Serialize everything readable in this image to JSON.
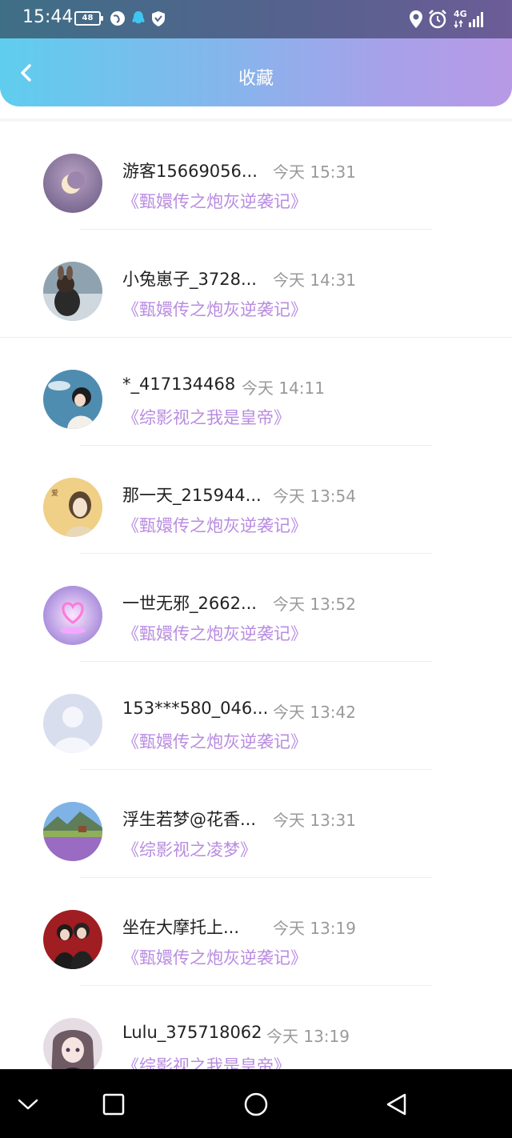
{
  "status": {
    "time": "15:44",
    "battery": "48",
    "network": "4G"
  },
  "header": {
    "title": "收藏"
  },
  "items": [
    {
      "name": "游客15669056...",
      "time": "今天 15:31",
      "book": "《甄嬛传之炮灰逆袭记》",
      "avatar": "moon-avatar"
    },
    {
      "name": "小兔崽子_3728...",
      "time": "今天 14:31",
      "book": "《甄嬛传之炮灰逆袭记》",
      "avatar": "bunny-avatar"
    },
    {
      "name": "*_417134468",
      "time": "今天 14:11",
      "book": "《综影视之我是皇帝》",
      "avatar": "girl-sky-avatar"
    },
    {
      "name": "那一天_215944...",
      "time": "今天 13:54",
      "book": "《甄嬛传之炮灰逆袭记》",
      "avatar": "painted-girl-avatar"
    },
    {
      "name": "一世无邪_2662...",
      "time": "今天 13:52",
      "book": "《甄嬛传之炮灰逆袭记》",
      "avatar": "heart-avatar"
    },
    {
      "name": "153***580_046...",
      "time": "今天 13:42",
      "book": "《甄嬛传之炮灰逆袭记》",
      "avatar": "default-avatar"
    },
    {
      "name": "浮生若梦@花香...",
      "time": "今天 13:31",
      "book": "《综影视之凌梦》",
      "avatar": "lavender-field-avatar"
    },
    {
      "name": "坐在大摩托上...",
      "time": "今天 13:19",
      "book": "《甄嬛传之炮灰逆袭记》",
      "avatar": "couple-avatar"
    },
    {
      "name": "Lulu_375718062",
      "time": "今天 13:19",
      "book": "《综影视之我是皇帝》",
      "avatar": "anime-girl-avatar"
    }
  ],
  "colors": {
    "book_title": "#b88ce0",
    "time": "#9a9a9a",
    "header_start": "#5fcdee",
    "header_end": "#b899e6"
  }
}
